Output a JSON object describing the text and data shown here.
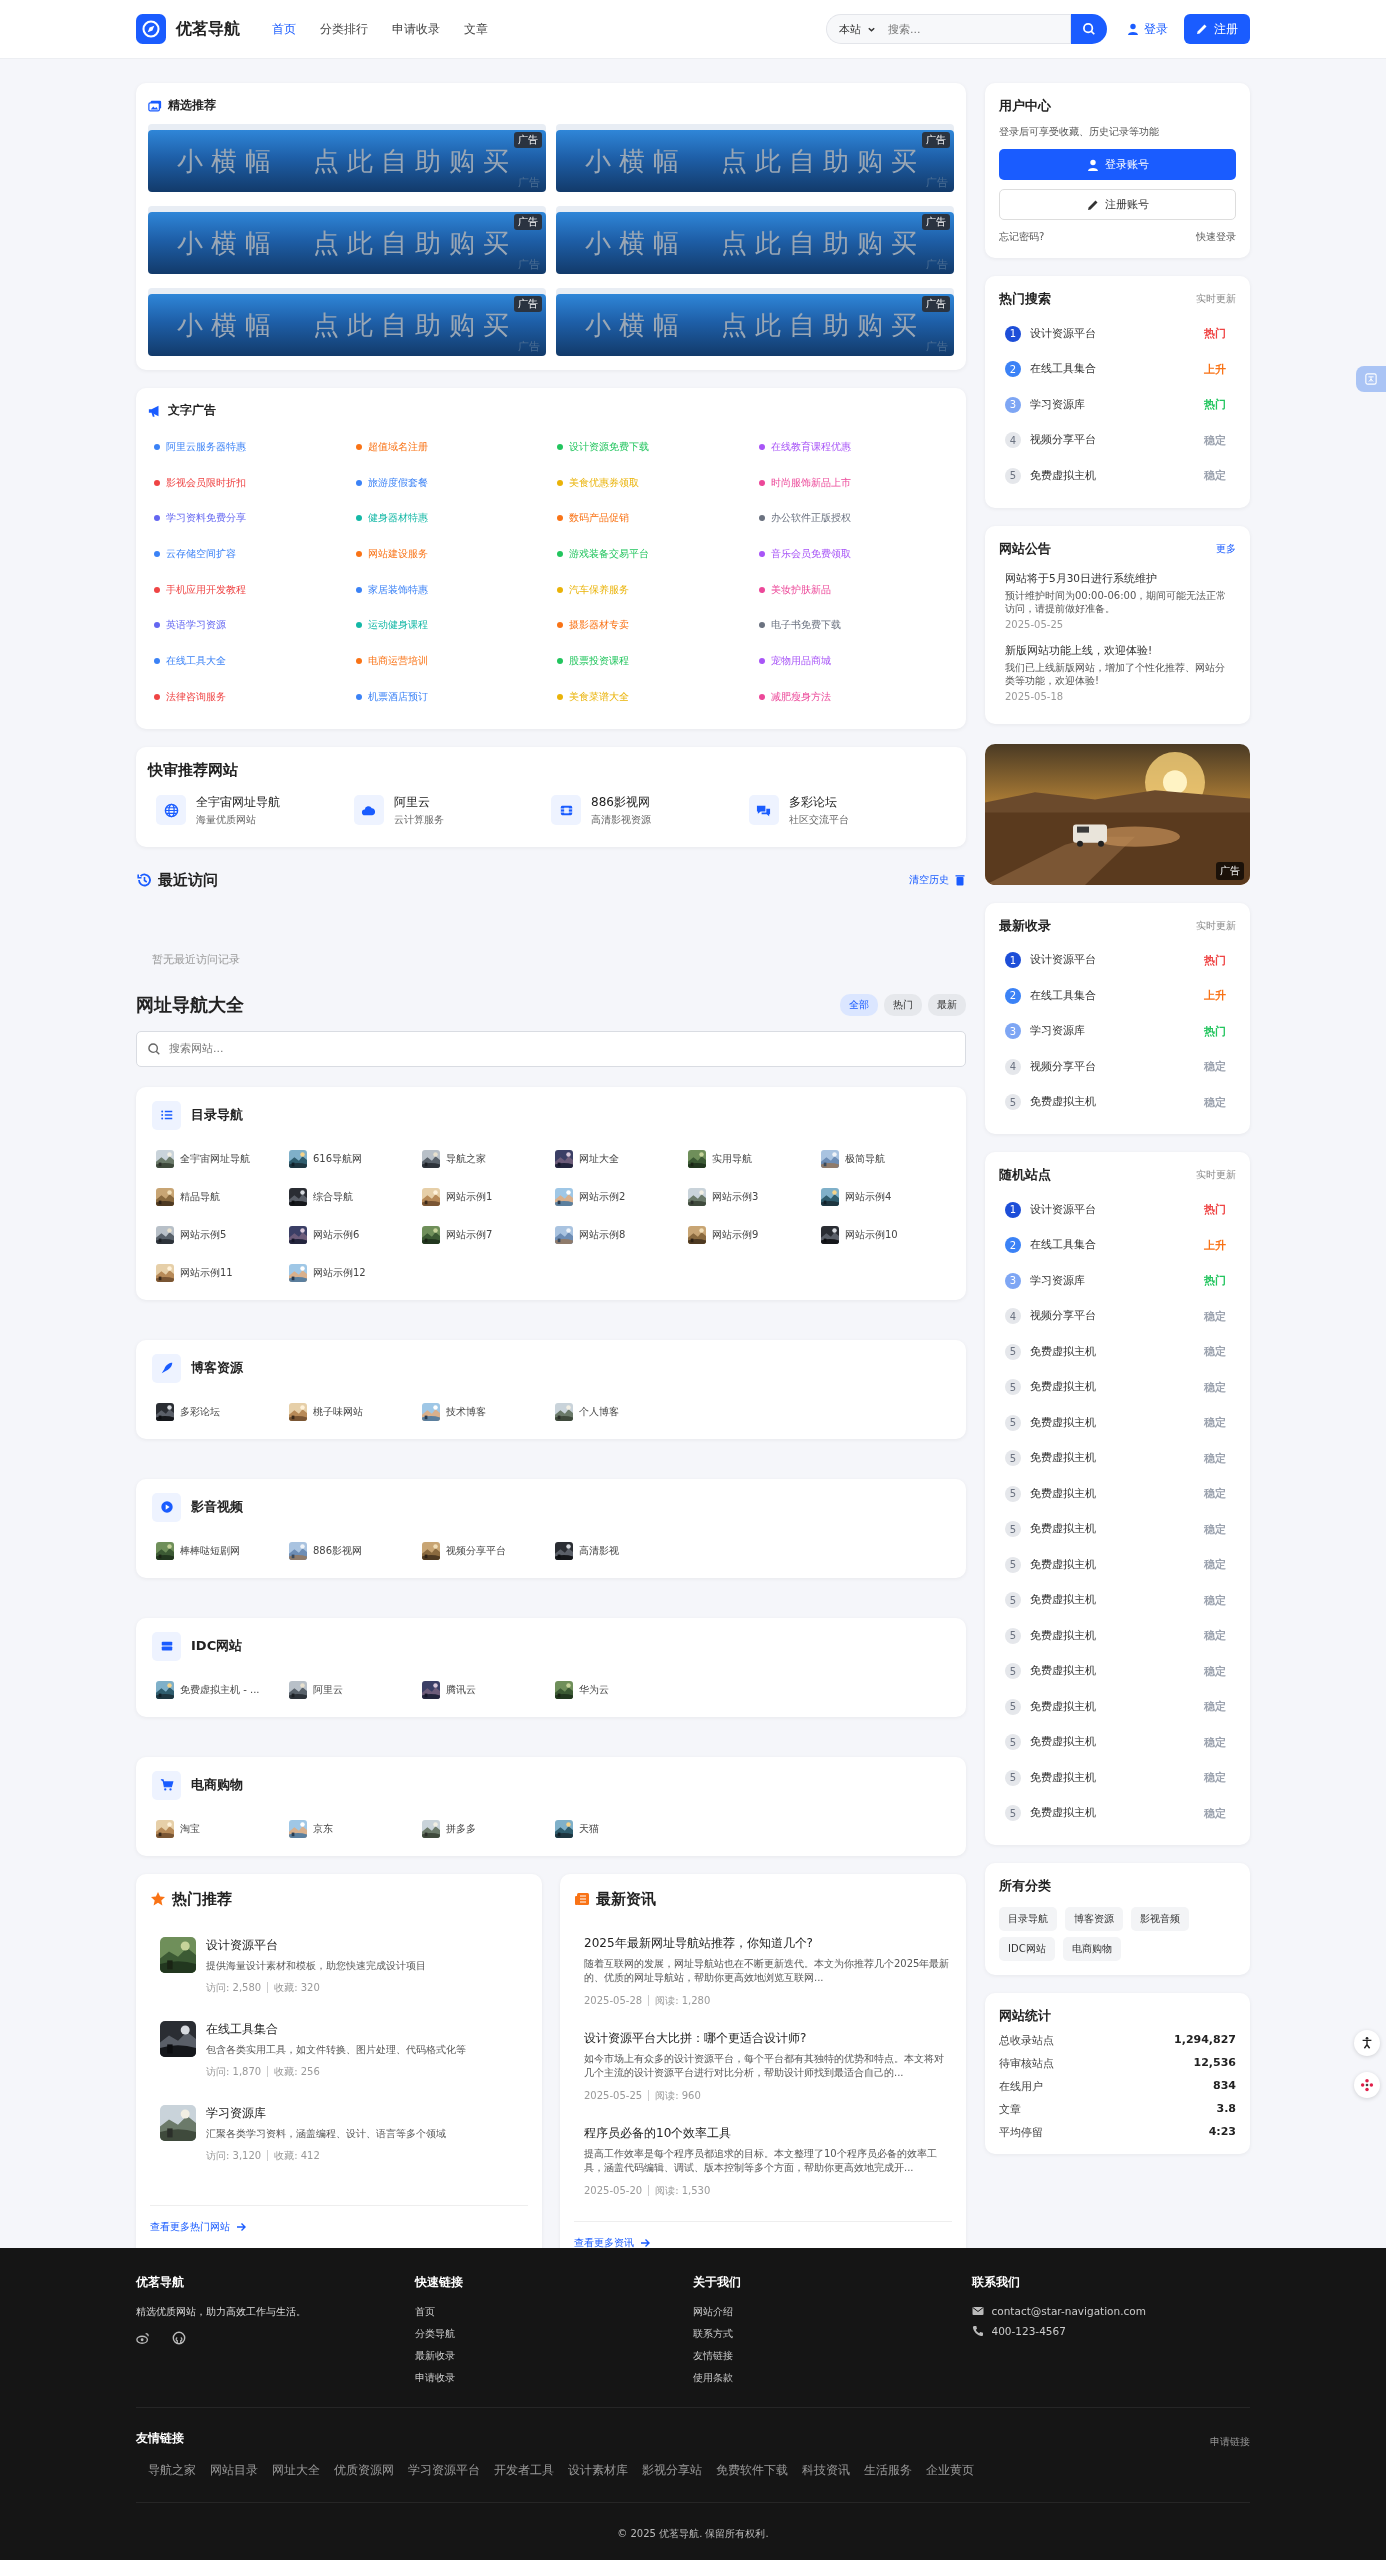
{
  "header": {
    "logo_text": "优茗导航",
    "nav": [
      {
        "label": "首页",
        "selected": true
      },
      {
        "label": "分类排行",
        "selected": false
      },
      {
        "label": "申请收录",
        "selected": false
      },
      {
        "label": "文章",
        "selected": false
      }
    ],
    "search": {
      "scope": "本站",
      "placeholder": "搜索..."
    },
    "login": "登录",
    "register": "注册"
  },
  "featured": {
    "title": "精选推荐",
    "banners": [
      {
        "text": "小横幅　点此自助购买",
        "badge": "广告",
        "corner": "广告"
      },
      {
        "text": "小横幅　点此自助购买",
        "badge": "广告",
        "corner": "广告"
      },
      {
        "text": "小横幅　点此自助购买",
        "badge": "广告",
        "corner": "广告"
      },
      {
        "text": "小横幅　点此自助购买",
        "badge": "广告",
        "corner": "广告"
      },
      {
        "text": "小横幅　点此自助购买",
        "badge": "广告",
        "corner": "广告"
      },
      {
        "text": "小横幅　点此自助购买",
        "badge": "广告",
        "corner": "广告"
      }
    ]
  },
  "text_ads": {
    "title": "文字广告",
    "items": [
      {
        "label": "阿里云服务器特惠",
        "color": "#3b82f6"
      },
      {
        "label": "超值域名注册",
        "color": "#f97316"
      },
      {
        "label": "设计资源免费下载",
        "color": "#22c55e"
      },
      {
        "label": "在线教育课程优惠",
        "color": "#a855f7"
      },
      {
        "label": "影视会员限时折扣",
        "color": "#ef4444"
      },
      {
        "label": "旅游度假套餐",
        "color": "#3b82f6"
      },
      {
        "label": "美食优惠券领取",
        "color": "#eab308"
      },
      {
        "label": "时尚服饰新品上市",
        "color": "#ec4899"
      },
      {
        "label": "学习资料免费分享",
        "color": "#6366f1"
      },
      {
        "label": "健身器材特惠",
        "color": "#14b8a6"
      },
      {
        "label": "数码产品促销",
        "color": "#f97316"
      },
      {
        "label": "办公软件正版授权",
        "color": "#6b7280"
      },
      {
        "label": "云存储空间扩容",
        "color": "#3b82f6"
      },
      {
        "label": "网站建设服务",
        "color": "#f97316"
      },
      {
        "label": "游戏装备交易平台",
        "color": "#22c55e"
      },
      {
        "label": "音乐会员免费领取",
        "color": "#a855f7"
      },
      {
        "label": "手机应用开发教程",
        "color": "#ef4444"
      },
      {
        "label": "家居装饰特惠",
        "color": "#3b82f6"
      },
      {
        "label": "汽车保养服务",
        "color": "#eab308"
      },
      {
        "label": "美妆护肤新品",
        "color": "#ec4899"
      },
      {
        "label": "英语学习资源",
        "color": "#6366f1"
      },
      {
        "label": "运动健身课程",
        "color": "#14b8a6"
      },
      {
        "label": "摄影器材专卖",
        "color": "#f97316"
      },
      {
        "label": "电子书免费下载",
        "color": "#6b7280"
      },
      {
        "label": "在线工具大全",
        "color": "#3b82f6"
      },
      {
        "label": "电商运营培训",
        "color": "#f97316"
      },
      {
        "label": "股票投资课程",
        "color": "#22c55e"
      },
      {
        "label": "宠物用品商城",
        "color": "#a855f7"
      },
      {
        "label": "法律咨询服务",
        "color": "#ef4444"
      },
      {
        "label": "机票酒店预订",
        "color": "#3b82f6"
      },
      {
        "label": "美食菜谱大全",
        "color": "#eab308"
      },
      {
        "label": "减肥瘦身方法",
        "color": "#ec4899"
      }
    ]
  },
  "quick": {
    "title": "快审推荐网站",
    "sites": [
      {
        "name": "全宇宙网址导航",
        "desc": "海量优质网站",
        "kind": "globe"
      },
      {
        "name": "阿里云",
        "desc": "云计算服务",
        "kind": "cloud"
      },
      {
        "name": "886影视网",
        "desc": "高清影视资源",
        "kind": "film"
      },
      {
        "name": "多彩论坛",
        "desc": "社区交流平台",
        "kind": "chat"
      }
    ]
  },
  "recent": {
    "title": "最近访问",
    "clear": "清空历史",
    "empty": "暂无最近访问记录"
  },
  "directory": {
    "title": "网址导航大全",
    "filters": [
      {
        "label": "全部",
        "selected": true
      },
      {
        "label": "热门",
        "selected": false
      },
      {
        "label": "最新",
        "selected": false
      }
    ],
    "search_placeholder": "搜索网站...",
    "categories": [
      {
        "title": "目录导航",
        "kind": "list",
        "sites": [
          "全宇宙网址导航",
          "616导航网",
          "导航之家",
          "网址大全",
          "实用导航",
          "极简导航",
          "精品导航",
          "综合导航",
          "网站示例1",
          "网站示例2",
          "网站示例3",
          "网站示例4",
          "网站示例5",
          "网站示例6",
          "网站示例7",
          "网站示例8",
          "网站示例9",
          "网站示例10",
          "网站示例11",
          "网站示例12"
        ]
      },
      {
        "title": "博客资源",
        "kind": "pen",
        "sites": [
          "多彩论坛",
          "桃子味网站",
          "技术博客",
          "个人博客"
        ]
      },
      {
        "title": "影音视频",
        "kind": "play",
        "sites": [
          "棒棒哒短剧网",
          "886影视网",
          "视频分享平台",
          "高清影视"
        ]
      },
      {
        "title": "IDC网站",
        "kind": "server",
        "sites": [
          "免费虚拟主机 - ...",
          "阿里云",
          "腾讯云",
          "华为云"
        ]
      },
      {
        "title": "电商购物",
        "kind": "cart",
        "sites": [
          "淘宝",
          "京东",
          "拼多多",
          "天猫"
        ]
      }
    ]
  },
  "hot": {
    "title": "热门推荐",
    "items": [
      {
        "name": "设计资源平台",
        "desc": "提供海量设计素材和模板，助您快速完成设计项目",
        "visits": "访问: 2,580",
        "favs": "收藏: 320"
      },
      {
        "name": "在线工具集合",
        "desc": "包含各类实用工具，如文件转换、图片处理、代码格式化等",
        "visits": "访问: 1,870",
        "favs": "收藏: 256"
      },
      {
        "name": "学习资源库",
        "desc": "汇聚各类学习资料，涵盖编程、设计、语言等多个领域",
        "visits": "访问: 3,120",
        "favs": "收藏: 412"
      }
    ],
    "more": "查看更多热门网站"
  },
  "news": {
    "title": "最新资讯",
    "items": [
      {
        "title": "2025年最新网址导航站推荐，你知道几个?",
        "excerpt": "随着互联网的发展，网址导航站也在不断更新迭代。本文为你推荐几个2025年最新的、优质的网址导航站，帮助你更高效地浏览互联网...",
        "date": "2025-05-28",
        "reads": "阅读: 1,280"
      },
      {
        "title": "设计资源平台大比拼：哪个更适合设计师?",
        "excerpt": "如今市场上有众多的设计资源平台，每个平台都有其独特的优势和特点。本文将对几个主流的设计资源平台进行对比分析，帮助设计师找到最适合自己的...",
        "date": "2025-05-25",
        "reads": "阅读: 960"
      },
      {
        "title": "程序员必备的10个效率工具",
        "excerpt": "提高工作效率是每个程序员都追求的目标。本文整理了10个程序员必备的效率工具，涵盖代码编辑、调试、版本控制等多个方面，帮助你更高效地完成开...",
        "date": "2025-05-20",
        "reads": "阅读: 1,530"
      }
    ],
    "more": "查看更多资讯"
  },
  "user_center": {
    "title": "用户中心",
    "desc": "登录后可享受收藏、历史记录等功能",
    "login": "登录账号",
    "register": "注册账号",
    "forgot": "忘记密码?",
    "quick_login": "快速登录"
  },
  "hot_search": {
    "title": "热门搜索",
    "note": "实时更新",
    "items": [
      {
        "rank": "1",
        "name": "设计资源平台",
        "trend": "热门",
        "color": "#ef4444"
      },
      {
        "rank": "2",
        "name": "在线工具集合",
        "trend": "上升",
        "color": "#f97316"
      },
      {
        "rank": "3",
        "name": "学习资源库",
        "trend": "热门",
        "color": "#22c55e"
      },
      {
        "rank": "4",
        "name": "视频分享平台",
        "trend": "稳定",
        "color": "#9ca3af"
      },
      {
        "rank": "5",
        "name": "免费虚拟主机",
        "trend": "稳定",
        "color": "#9ca3af"
      }
    ]
  },
  "notices": {
    "title": "网站公告",
    "more": "更多",
    "items": [
      {
        "title": "网站将于5月30日进行系统维护",
        "body": "预计维护时间为00:00-06:00，期间可能无法正常访问，请提前做好准备。",
        "date": "2025-05-25"
      },
      {
        "title": "新版网站功能上线，欢迎体验!",
        "body": "我们已上线新版网站，增加了个性化推荐、网站分类等功能，欢迎体验!",
        "date": "2025-05-18"
      }
    ]
  },
  "side_ad": {
    "kind": "picture",
    "badge": "广告"
  },
  "latest": {
    "title": "最新收录",
    "note": "实时更新",
    "items": [
      {
        "rank": "1",
        "name": "设计资源平台",
        "trend": "热门",
        "color": "#ef4444"
      },
      {
        "rank": "2",
        "name": "在线工具集合",
        "trend": "上升",
        "color": "#f97316"
      },
      {
        "rank": "3",
        "name": "学习资源库",
        "trend": "热门",
        "color": "#22c55e"
      },
      {
        "rank": "4",
        "name": "视频分享平台",
        "trend": "稳定",
        "color": "#9ca3af"
      },
      {
        "rank": "5",
        "name": "免费虚拟主机",
        "trend": "稳定",
        "color": "#9ca3af"
      }
    ]
  },
  "random": {
    "title": "随机站点",
    "note": "实时更新",
    "items": [
      {
        "rank": "1",
        "name": "设计资源平台",
        "trend": "热门",
        "color": "#ef4444"
      },
      {
        "rank": "2",
        "name": "在线工具集合",
        "trend": "上升",
        "color": "#f97316"
      },
      {
        "rank": "3",
        "name": "学习资源库",
        "trend": "热门",
        "color": "#22c55e"
      },
      {
        "rank": "4",
        "name": "视频分享平台",
        "trend": "稳定",
        "color": "#9ca3af"
      },
      {
        "rank": "5",
        "name": "免费虚拟主机",
        "trend": "稳定",
        "color": "#9ca3af"
      },
      {
        "rank": "5",
        "name": "免费虚拟主机",
        "trend": "稳定",
        "color": "#9ca3af"
      },
      {
        "rank": "5",
        "name": "免费虚拟主机",
        "trend": "稳定",
        "color": "#9ca3af"
      },
      {
        "rank": "5",
        "name": "免费虚拟主机",
        "trend": "稳定",
        "color": "#9ca3af"
      },
      {
        "rank": "5",
        "name": "免费虚拟主机",
        "trend": "稳定",
        "color": "#9ca3af"
      },
      {
        "rank": "5",
        "name": "免费虚拟主机",
        "trend": "稳定",
        "color": "#9ca3af"
      },
      {
        "rank": "5",
        "name": "免费虚拟主机",
        "trend": "稳定",
        "color": "#9ca3af"
      },
      {
        "rank": "5",
        "name": "免费虚拟主机",
        "trend": "稳定",
        "color": "#9ca3af"
      },
      {
        "rank": "5",
        "name": "免费虚拟主机",
        "trend": "稳定",
        "color": "#9ca3af"
      },
      {
        "rank": "5",
        "name": "免费虚拟主机",
        "trend": "稳定",
        "color": "#9ca3af"
      },
      {
        "rank": "5",
        "name": "免费虚拟主机",
        "trend": "稳定",
        "color": "#9ca3af"
      },
      {
        "rank": "5",
        "name": "免费虚拟主机",
        "trend": "稳定",
        "color": "#9ca3af"
      },
      {
        "rank": "5",
        "name": "免费虚拟主机",
        "trend": "稳定",
        "color": "#9ca3af"
      },
      {
        "rank": "5",
        "name": "免费虚拟主机",
        "trend": "稳定",
        "color": "#9ca3af"
      }
    ]
  },
  "all_categories": {
    "title": "所有分类",
    "tags": [
      "目录导航",
      "博客资源",
      "影视音频",
      "IDC网站",
      "电商购物"
    ]
  },
  "stats": {
    "title": "网站统计",
    "rows": [
      {
        "label": "总收录站点",
        "value": "1,294,827"
      },
      {
        "label": "待审核站点",
        "value": "12,536"
      },
      {
        "label": "在线用户",
        "value": "834"
      },
      {
        "label": "文章",
        "value": "3.8"
      },
      {
        "label": "平均停留",
        "value": "4:23"
      }
    ]
  },
  "footer": {
    "brand": "优茗导航",
    "tagline": "精选优质网站，助力高效工作与生活。",
    "columns": [
      {
        "title": "快速链接",
        "links": [
          "首页",
          "分类导航",
          "最新收录",
          "申请收录"
        ]
      },
      {
        "title": "关于我们",
        "links": [
          "网站介绍",
          "联系方式",
          "友情链接",
          "使用条款"
        ]
      }
    ],
    "contact": {
      "title": "联系我们",
      "email": "contact@star-navigation.com",
      "phone": "400-123-4567"
    },
    "friends": {
      "title": "友情链接",
      "apply": "申请链接",
      "links": [
        "导航之家",
        "网站目录",
        "网址大全",
        "优质资源网",
        "学习资源平台",
        "开发者工具",
        "设计素材库",
        "影视分享站",
        "免费软件下载",
        "科技资讯",
        "生活服务",
        "企业黄页"
      ]
    },
    "copyright": "© 2025 优茗导航. 保留所有权利."
  }
}
